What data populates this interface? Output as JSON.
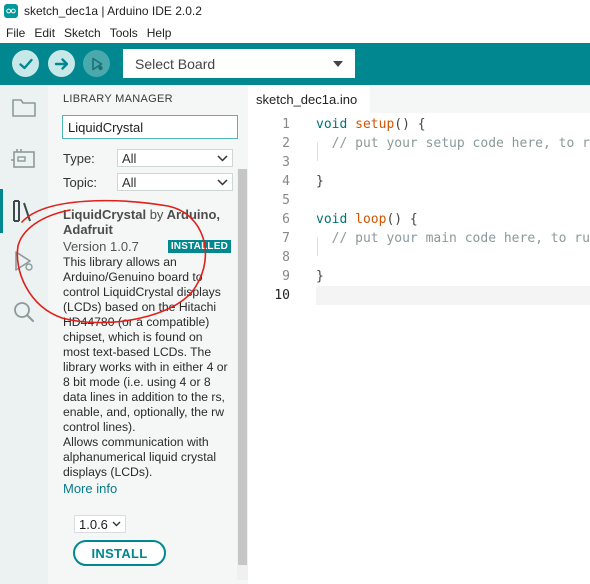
{
  "window": {
    "title": "sketch_dec1a | Arduino IDE 2.0.2"
  },
  "menu": [
    "File",
    "Edit",
    "Sketch",
    "Tools",
    "Help"
  ],
  "toolbar": {
    "verify_icon": "check-icon",
    "upload_icon": "arrow-right-icon",
    "debug_icon": "debug-icon",
    "board_select": "Select Board"
  },
  "sidebar": {
    "icons": [
      "folder-icon",
      "board-icon",
      "library-icon",
      "debug-icon",
      "search-icon"
    ],
    "active": "library-icon"
  },
  "library_manager": {
    "title": "LIBRARY MANAGER",
    "search_value": "LiquidCrystal",
    "type_label": "Type:",
    "type_value": "All",
    "topic_label": "Topic:",
    "topic_value": "All",
    "card": {
      "name": "LiquidCrystal",
      "by": "by",
      "author": "Arduino, Adafruit",
      "version": "Version 1.0.7",
      "badge": "INSTALLED",
      "description1": "This library allows an Arduino/Genuino board to control LiquidCrystal displays (LCDs) based on the Hitachi HD44780 (or a compatible) chipset, which is found on most text-based LCDs. The library works with in either 4 or 8 bit mode (i.e. using 4 or 8 data lines in addition to the rs, enable, and, optionally, the rw control lines).",
      "description2": "Allows communication with alphanumerical liquid crystal displays (LCDs).",
      "more_info": "More info",
      "selected_version": "1.0.6",
      "install_label": "INSTALL"
    }
  },
  "editor": {
    "tab": "sketch_dec1a.ino",
    "lines": [
      {
        "num": "1",
        "code": "void setup() {"
      },
      {
        "num": "2",
        "code": "  // put your setup code here, to run once:"
      },
      {
        "num": "3",
        "code": ""
      },
      {
        "num": "4",
        "code": "}"
      },
      {
        "num": "5",
        "code": ""
      },
      {
        "num": "6",
        "code": "void loop() {"
      },
      {
        "num": "7",
        "code": "  // put your main code here, to run repeatedly:"
      },
      {
        "num": "8",
        "code": ""
      },
      {
        "num": "9",
        "code": "}"
      },
      {
        "num": "10",
        "code": ""
      }
    ],
    "current_line": "10"
  },
  "colors": {
    "accent": "#00878f",
    "annotation": "#e0201a"
  }
}
